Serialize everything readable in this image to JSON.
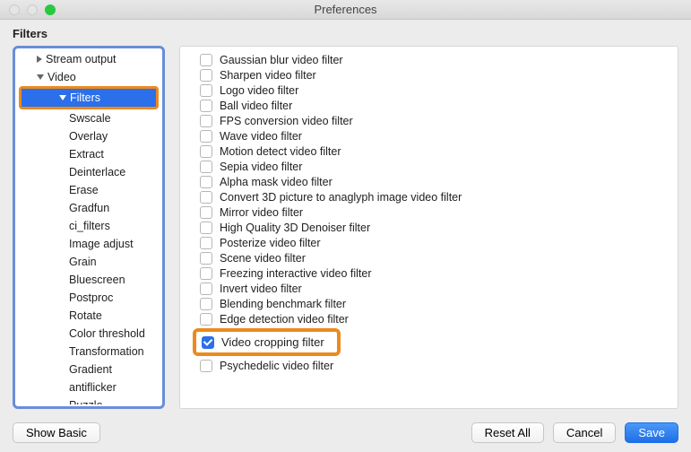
{
  "window": {
    "title": "Preferences"
  },
  "section_title": "Filters",
  "sidebar": {
    "items": [
      {
        "label": "Stream output",
        "level": 1,
        "arrow": "right"
      },
      {
        "label": "Video",
        "level": 1,
        "arrow": "down"
      },
      {
        "label": "Filters",
        "level": 2,
        "arrow": "down",
        "selected": true,
        "highlight": true
      },
      {
        "label": "Swscale",
        "level": 3
      },
      {
        "label": "Overlay",
        "level": 3
      },
      {
        "label": "Extract",
        "level": 3
      },
      {
        "label": "Deinterlace",
        "level": 3
      },
      {
        "label": "Erase",
        "level": 3
      },
      {
        "label": "Gradfun",
        "level": 3
      },
      {
        "label": "ci_filters",
        "level": 3
      },
      {
        "label": "Image adjust",
        "level": 3
      },
      {
        "label": "Grain",
        "level": 3
      },
      {
        "label": "Bluescreen",
        "level": 3
      },
      {
        "label": "Postproc",
        "level": 3
      },
      {
        "label": "Rotate",
        "level": 3
      },
      {
        "label": "Color threshold",
        "level": 3
      },
      {
        "label": "Transformation",
        "level": 3
      },
      {
        "label": "Gradient",
        "level": 3
      },
      {
        "label": "antiflicker",
        "level": 3
      },
      {
        "label": "Puzzle",
        "level": 3
      }
    ]
  },
  "filters": [
    {
      "label": "Gaussian blur video filter",
      "checked": false
    },
    {
      "label": "Sharpen video filter",
      "checked": false
    },
    {
      "label": "Logo video filter",
      "checked": false
    },
    {
      "label": "Ball video filter",
      "checked": false
    },
    {
      "label": "FPS conversion video filter",
      "checked": false
    },
    {
      "label": "Wave video filter",
      "checked": false
    },
    {
      "label": "Motion detect video filter",
      "checked": false
    },
    {
      "label": "Sepia video filter",
      "checked": false
    },
    {
      "label": "Alpha mask video filter",
      "checked": false
    },
    {
      "label": "Convert 3D picture to anaglyph image video filter",
      "checked": false
    },
    {
      "label": "Mirror video filter",
      "checked": false
    },
    {
      "label": "High Quality 3D Denoiser filter",
      "checked": false
    },
    {
      "label": "Posterize video filter",
      "checked": false
    },
    {
      "label": "Scene video filter",
      "checked": false
    },
    {
      "label": "Freezing interactive video filter",
      "checked": false
    },
    {
      "label": "Invert video filter",
      "checked": false
    },
    {
      "label": "Blending benchmark filter",
      "checked": false
    },
    {
      "label": "Edge detection video filter",
      "checked": false
    },
    {
      "label": "Video cropping filter",
      "checked": true,
      "highlight": true
    },
    {
      "label": "Psychedelic video filter",
      "checked": false
    }
  ],
  "footer": {
    "show_basic": "Show Basic",
    "reset_all": "Reset All",
    "cancel": "Cancel",
    "save": "Save"
  }
}
